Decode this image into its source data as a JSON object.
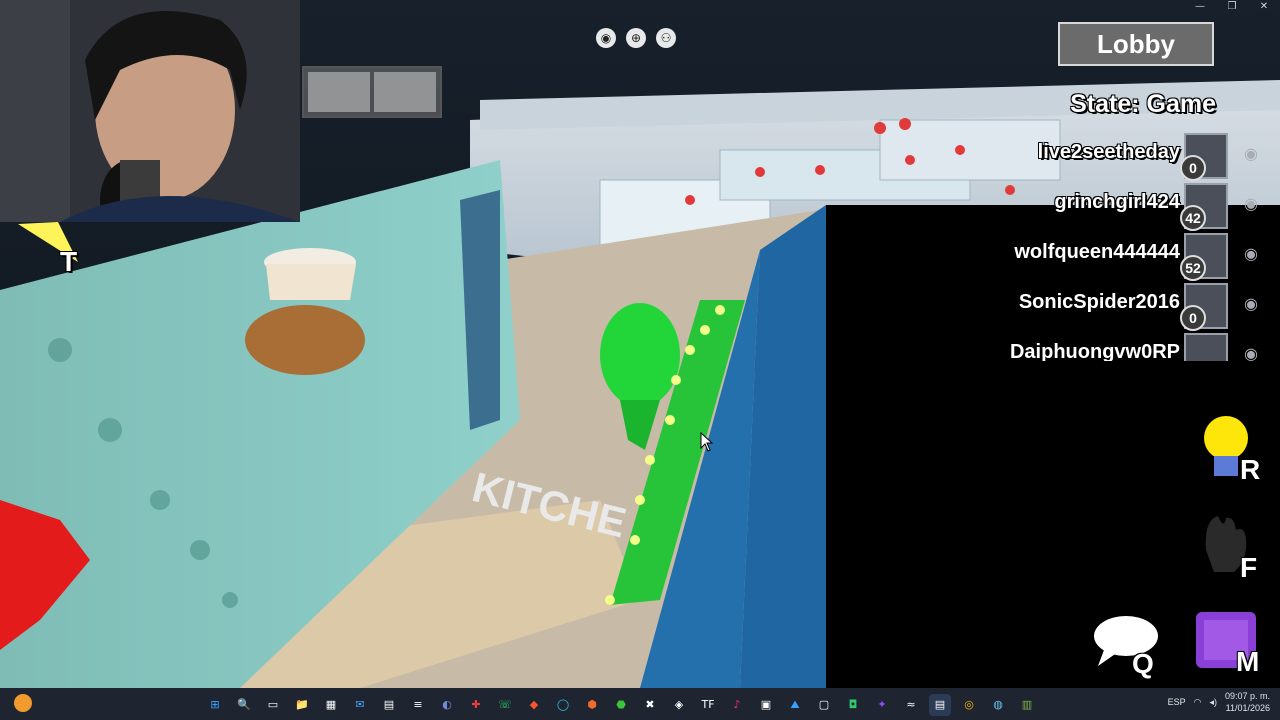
{
  "window": {
    "controls": [
      "—",
      "❐",
      "✕"
    ]
  },
  "top_icons": [
    {
      "name": "menu-icon",
      "glyph": "◉"
    },
    {
      "name": "globe-icon",
      "glyph": "⊕"
    },
    {
      "name": "players-icon",
      "glyph": "⚇"
    }
  ],
  "lobby_button": "Lobby",
  "state_label": "State: Game",
  "players": [
    {
      "name": "live2seetheday",
      "score": "0"
    },
    {
      "name": "grinchgirl424",
      "score": "42"
    },
    {
      "name": "wolfqueen444444",
      "score": "52"
    },
    {
      "name": "SonicSpider2016",
      "score": "0"
    },
    {
      "name": "Daiphuongvw0RP",
      "score": ""
    }
  ],
  "scene": {
    "floor_text": "KITCHE"
  },
  "key_hints": {
    "t": "T",
    "r": "R",
    "f": "F",
    "q": "Q",
    "m": "M"
  },
  "taskbar": {
    "apps": [
      "⊞",
      "🔍",
      "▭",
      "📁",
      "▦",
      "✉",
      "▤",
      "≡",
      "◐",
      "✚",
      "☏",
      "◆",
      "◯",
      "⬢",
      "⬣",
      "✖",
      "◈",
      "TF",
      "♪",
      "▣",
      "⛰",
      "▢",
      "◘",
      "✦",
      "≈",
      "▤",
      "◎",
      "◍",
      "▥"
    ],
    "tray_lang": "ESP",
    "time": "09:07 p. m.",
    "date": "11/01/2026"
  },
  "colors": {
    "accent_green": "#22d63a",
    "wall_teal": "#7fbcb6",
    "lobby_bg": "#6b6b6b"
  }
}
